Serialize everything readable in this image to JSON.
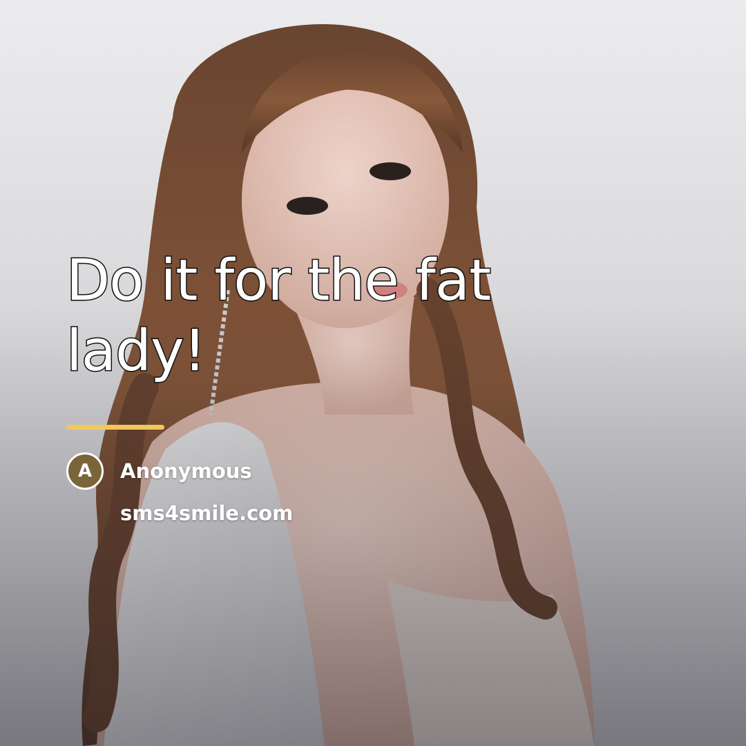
{
  "quote": {
    "text": "Do it for the fat lady!"
  },
  "author": {
    "initial": "A",
    "name": "Anonymous"
  },
  "site": {
    "domain": "sms4smile.com"
  },
  "colors": {
    "accent_underline": "#f2c75c",
    "avatar_bg": "#7a6439",
    "text": "#ffffff",
    "text_outline": "#111111"
  }
}
